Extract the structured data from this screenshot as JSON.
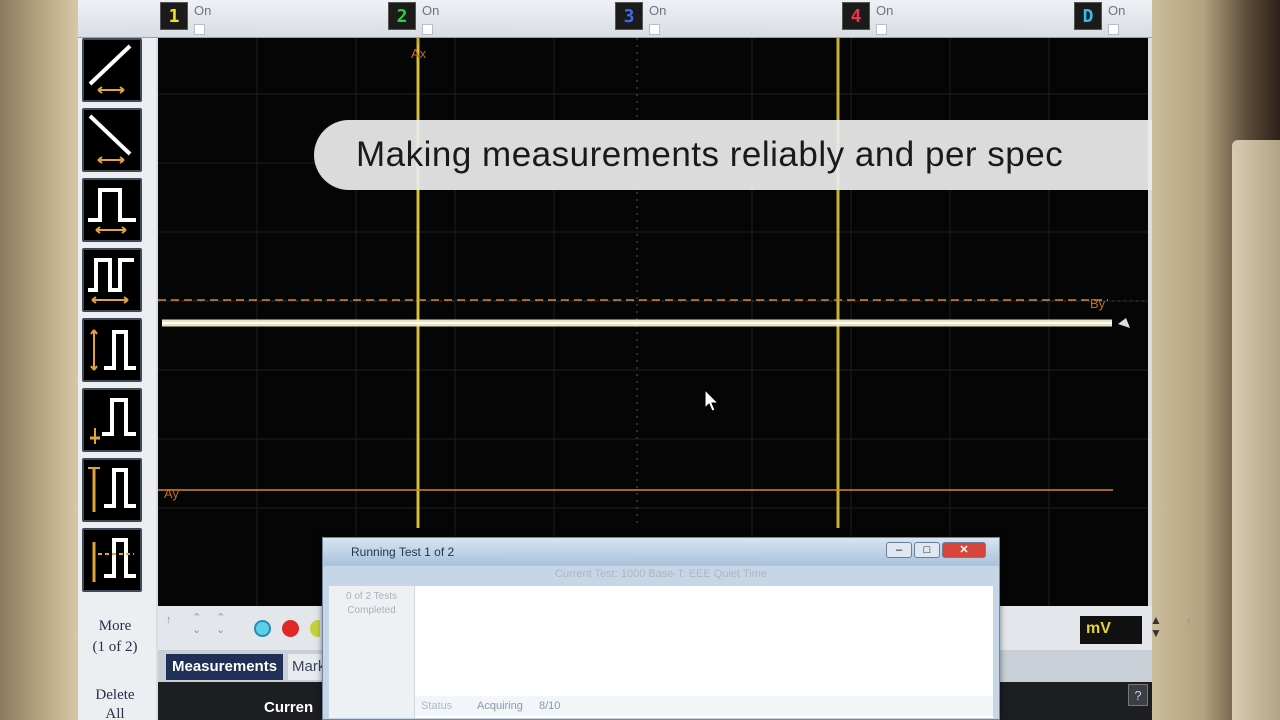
{
  "channels": [
    {
      "id": "1",
      "label": "On",
      "color": "#f2e21c"
    },
    {
      "id": "2",
      "label": "On",
      "color": "#28d23c"
    },
    {
      "id": "3",
      "label": "On",
      "color": "#3a6ef0"
    },
    {
      "id": "4",
      "label": "On",
      "color": "#f0324a"
    },
    {
      "id": "D",
      "label": "On",
      "color": "#3ab8f0"
    }
  ],
  "tools": {
    "items": [
      {
        "name": "rising-edge-tool-icon"
      },
      {
        "name": "falling-edge-tool-icon"
      },
      {
        "name": "pulse-width-tool-icon"
      },
      {
        "name": "period-tool-icon"
      },
      {
        "name": "amplitude-tool-icon"
      },
      {
        "name": "base-level-tool-icon"
      },
      {
        "name": "top-level-tool-icon"
      },
      {
        "name": "overshoot-tool-icon"
      }
    ],
    "more_label": "More",
    "more_page": "(1 of 2)",
    "delete_label_1": "Delete",
    "delete_label_2": "All"
  },
  "scope": {
    "marker_ax_top": "Ax",
    "marker_ay": "Ay",
    "marker_by": "By",
    "trace_color": "#f6f0c8",
    "marker_color": "#d4882a",
    "cursor_line_color": "#e6cf3a"
  },
  "caption": "Making measurements reliably and per spec",
  "bottom": {
    "voltage_field": "mV",
    "tab_measurements": "Measurements",
    "tab_markers": "Mark",
    "results_label": "Curren",
    "help": "?"
  },
  "dialog": {
    "title": "Running Test 1 of 2",
    "current_test": "Current Test: 1000 Base-T: EEE Quiet Time",
    "side_line1": "0 of 2 Tests",
    "side_line2": "Completed",
    "status_label": "Status",
    "status_value": "Acquiring",
    "status_count": "8/10"
  }
}
